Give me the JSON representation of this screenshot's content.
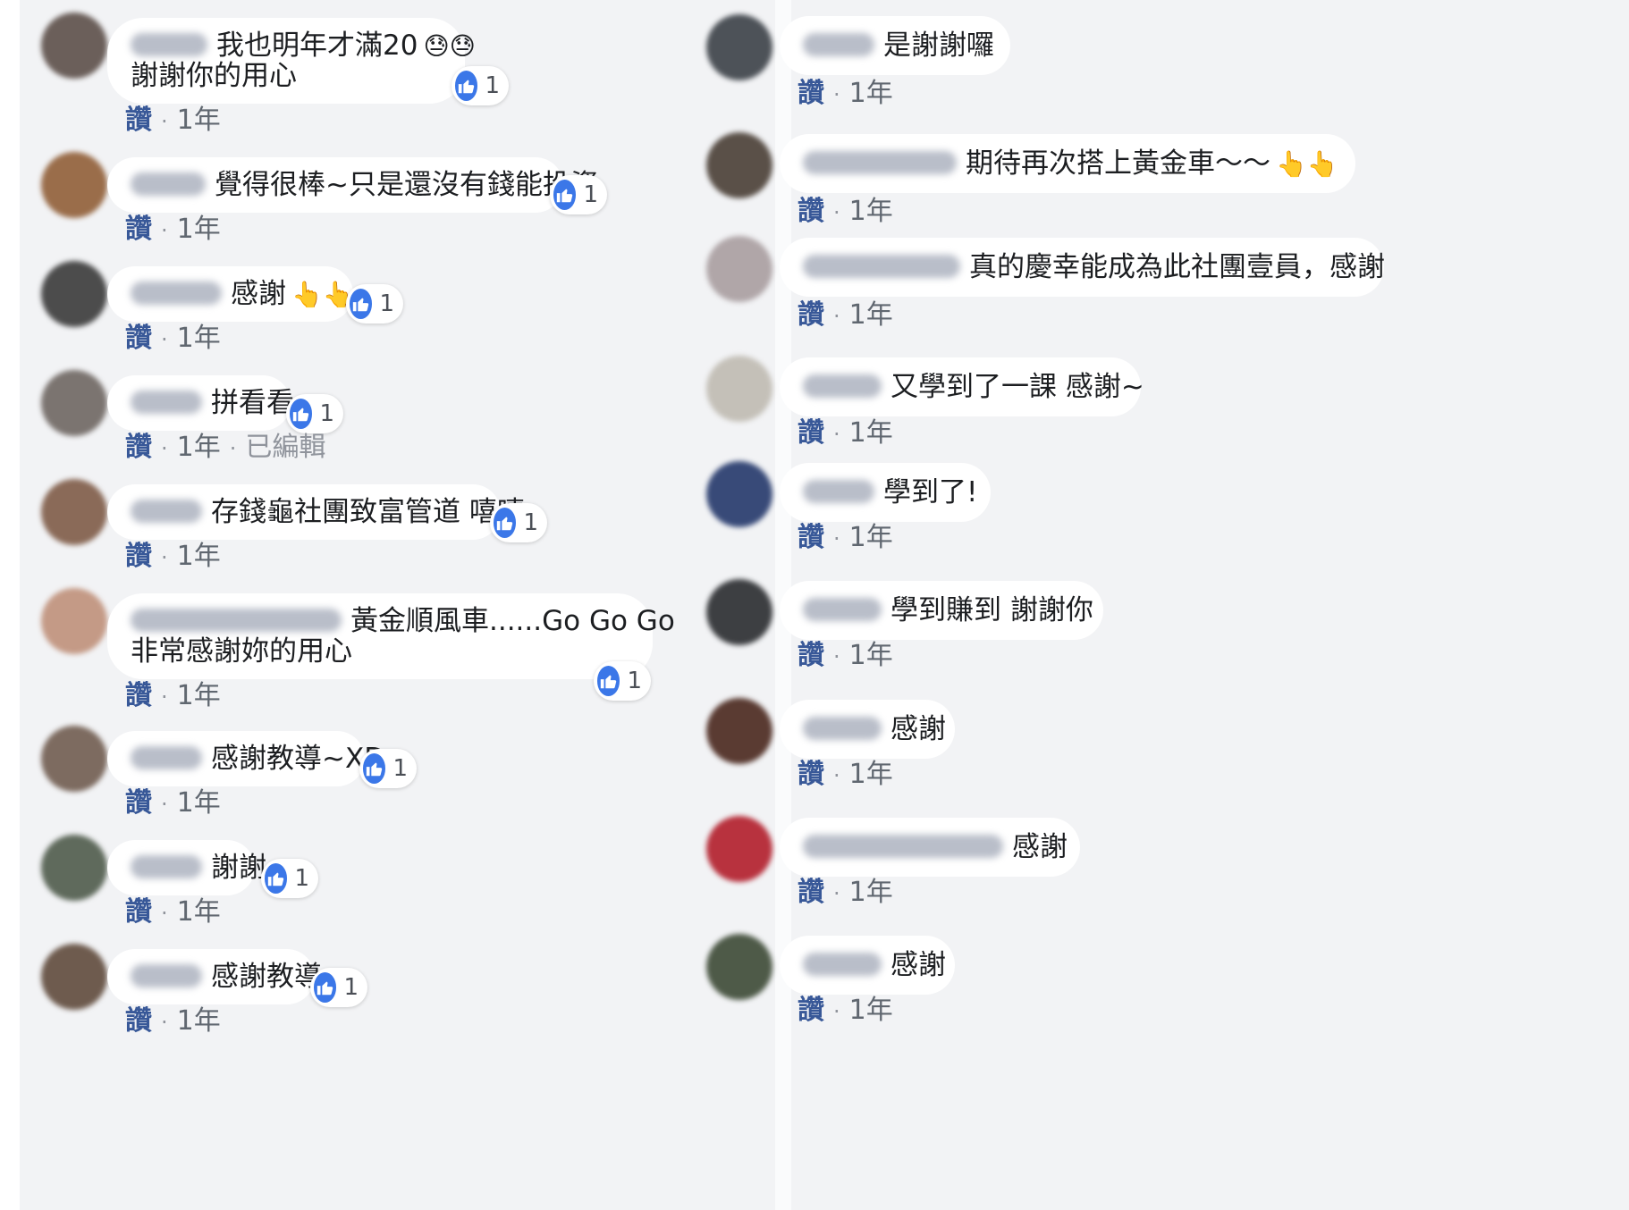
{
  "colors": {
    "background": "#f2f3f5",
    "bubble": "#ffffff",
    "link": "#385898",
    "like_blue": "#3b77e8",
    "meta_gray": "#606770"
  },
  "icons": {
    "like": "thumbs-up-icon",
    "dot": "·"
  },
  "left_comments": [
    {
      "line1": "我也明年才滿20",
      "emoji": "😓😓",
      "line2": "謝謝你的用心",
      "reaction_count": "1",
      "like_label": "讚",
      "time": "1年"
    },
    {
      "line1": "覺得很棒~只是還沒有錢能投資",
      "reaction_count": "1",
      "like_label": "讚",
      "time": "1年"
    },
    {
      "line1": "感謝",
      "emoji": "👆👆",
      "reaction_count": "1",
      "like_label": "讚",
      "time": "1年"
    },
    {
      "line1": "拼看看",
      "reaction_count": "1",
      "like_label": "讚",
      "time": "1年",
      "edited": "已編輯"
    },
    {
      "line1": "存錢龜社團致富管道 嘻嘻",
      "reaction_count": "1",
      "like_label": "讚",
      "time": "1年"
    },
    {
      "line1": "黃金順風車......Go Go Go",
      "line2": "非常感謝妳的用心",
      "reaction_count": "1",
      "like_label": "讚",
      "time": "1年"
    },
    {
      "line1": "感謝教導~XD",
      "reaction_count": "1",
      "like_label": "讚",
      "time": "1年"
    },
    {
      "line1": "謝謝",
      "reaction_count": "1",
      "like_label": "讚",
      "time": "1年"
    },
    {
      "line1": "感謝教導",
      "reaction_count": "1",
      "like_label": "讚",
      "time": "1年"
    }
  ],
  "right_comments": [
    {
      "line1": "是謝謝囉",
      "like_label": "讚",
      "time": "1年"
    },
    {
      "line1": "期待再次搭上黃金車～～",
      "emoji": "👆👆",
      "like_label": "讚",
      "time": "1年"
    },
    {
      "line1": "真的慶幸能成為此社團壹員，感謝",
      "like_label": "讚",
      "time": "1年"
    },
    {
      "line1": "又學到了一課 感謝~",
      "like_label": "讚",
      "time": "1年"
    },
    {
      "line1": "學到了!",
      "like_label": "讚",
      "time": "1年"
    },
    {
      "line1": "學到賺到 謝謝你",
      "like_label": "讚",
      "time": "1年"
    },
    {
      "line1": "感謝",
      "like_label": "讚",
      "time": "1年"
    },
    {
      "line1": "感謝",
      "like_label": "讚",
      "time": "1年"
    },
    {
      "line1": "感謝",
      "like_label": "讚",
      "time": "1年"
    }
  ]
}
